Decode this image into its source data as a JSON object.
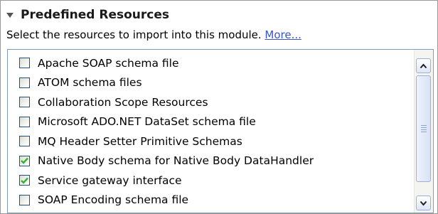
{
  "section": {
    "title": "Predefined Resources",
    "description": "Select the resources to import into this module. ",
    "more_link": "More..."
  },
  "resources": [
    {
      "label": "Apache SOAP schema file",
      "checked": false
    },
    {
      "label": "ATOM schema files",
      "checked": false
    },
    {
      "label": "Collaboration Scope Resources",
      "checked": false
    },
    {
      "label": "Microsoft ADO.NET DataSet schema file",
      "checked": false
    },
    {
      "label": "MQ Header Setter Primitive Schemas",
      "checked": false
    },
    {
      "label": "Native Body schema for Native Body DataHandler",
      "checked": true
    },
    {
      "label": "Service gateway interface",
      "checked": true
    },
    {
      "label": "SOAP Encoding schema file",
      "checked": false
    }
  ],
  "icons": {
    "twisty": "expanded-twisty-icon",
    "check": "checkmark-icon",
    "scroll_up": "arrow-up-icon",
    "scroll_down": "arrow-down-icon"
  },
  "colors": {
    "link": "#3a55c8",
    "check_mark": "#2db82d",
    "list_border": "#7f9db9"
  }
}
